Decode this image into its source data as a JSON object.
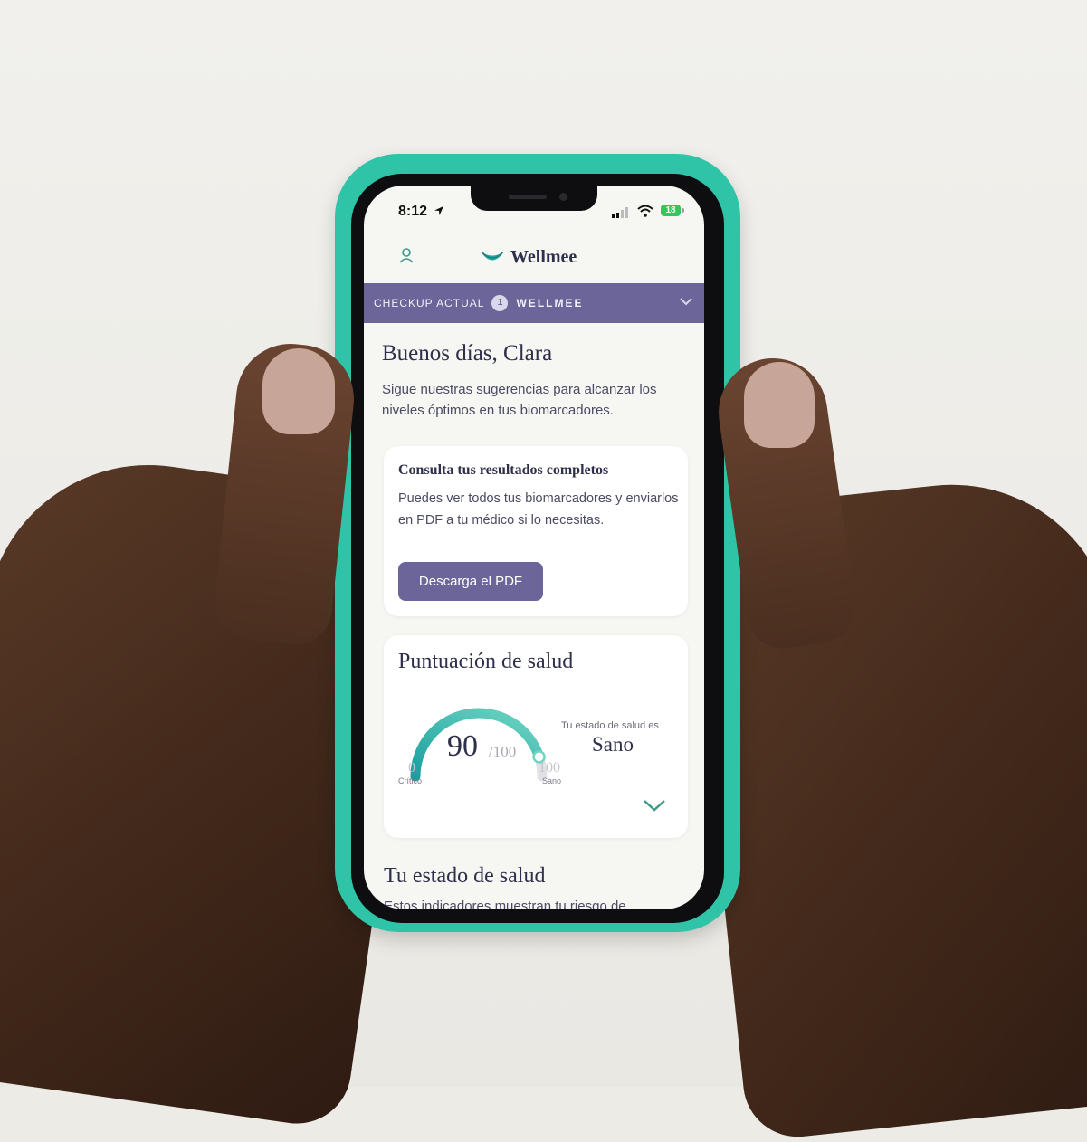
{
  "status_bar": {
    "time": "8:12",
    "battery": "18"
  },
  "app": {
    "name": "Wellmee"
  },
  "checkup_bar": {
    "label": "CHECKUP ACTUAL",
    "number": "1",
    "name": "WELLMEE"
  },
  "greeting": {
    "title": "Buenos días, Clara",
    "subtitle": "Sigue nuestras sugerencias para alcanzar los niveles óptimos en tus biomarcadores."
  },
  "pdf_card": {
    "title": "Consulta tus resultados completos",
    "body": "Puedes ver todos tus biomarcadores y enviarlos en PDF a tu médico si lo necesitas.",
    "button": "Descarga el PDF"
  },
  "score_card": {
    "title": "Puntuación de salud",
    "score": "90",
    "max": "/100",
    "score_fraction": 0.9,
    "min_tick": "0",
    "min_tick_label": "Crítico",
    "max_tick": "100",
    "max_tick_label": "Sano",
    "status_label": "Tu estado de salud es",
    "status_value": "Sano"
  },
  "health_section": {
    "title": "Tu estado de salud",
    "subtitle": "Estos indicadores muestran tu riesgo de"
  },
  "colors": {
    "accent": "#6b6599",
    "gauge_start": "#1a9fa0",
    "gauge_end": "#6fd6c2",
    "case": "#2fc4a7"
  },
  "icons": [
    "location-arrow-icon",
    "signal-icon",
    "wifi-icon",
    "user-icon",
    "wellmee-logo-icon",
    "chevron-down-icon"
  ]
}
